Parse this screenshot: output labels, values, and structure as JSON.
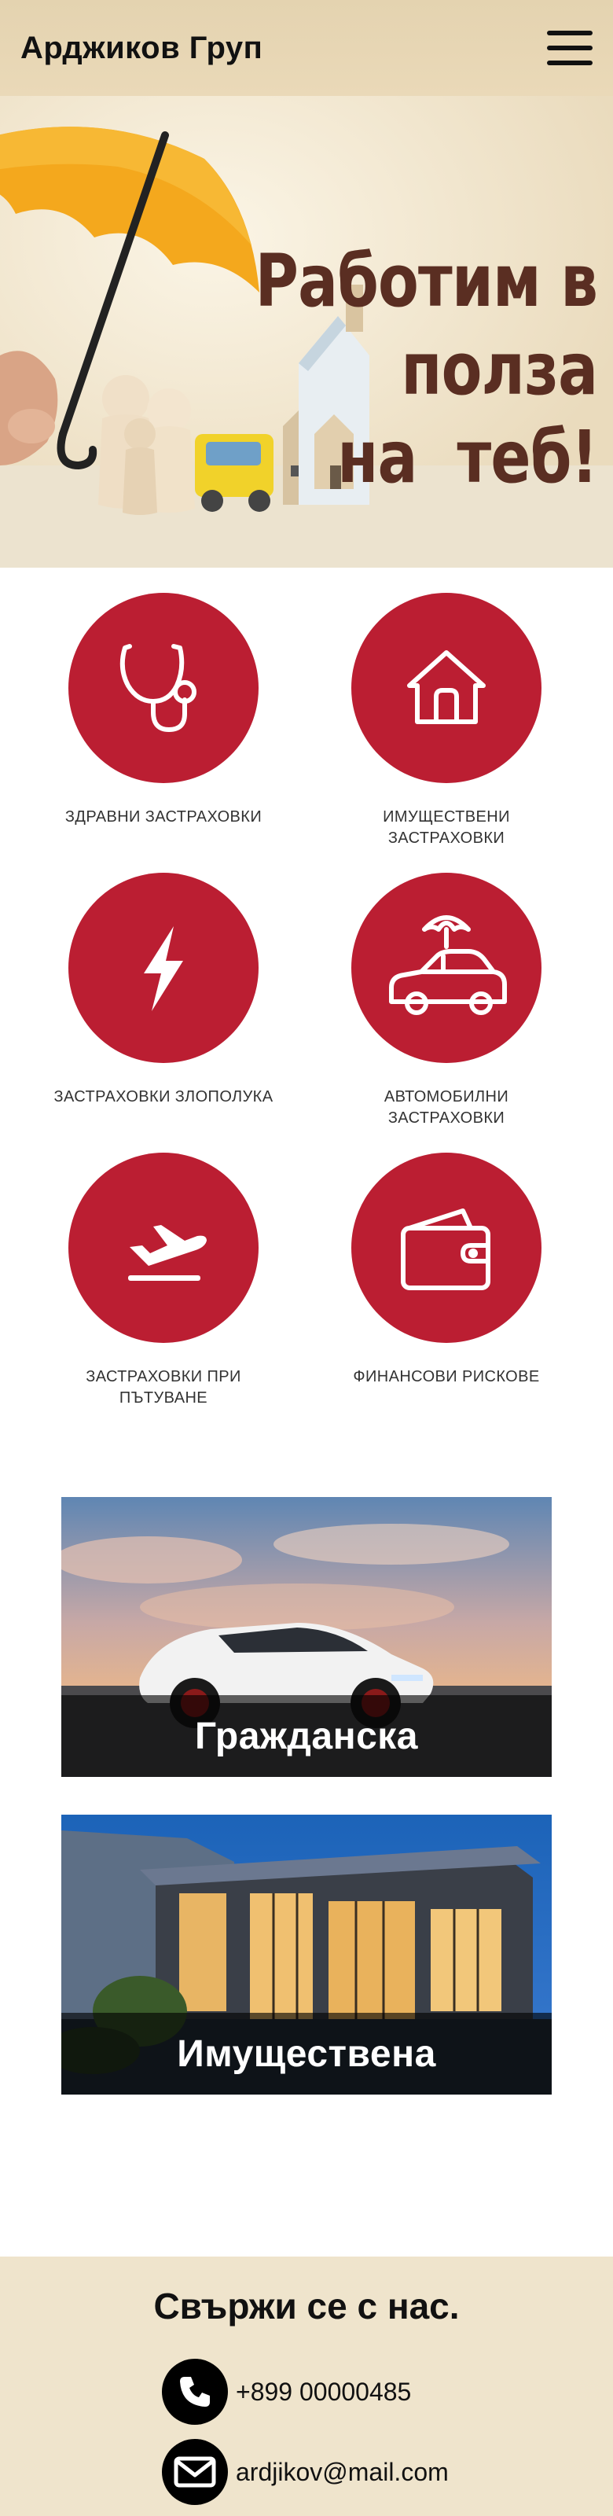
{
  "header": {
    "brand": "Арджиков Груп",
    "menu_icon": "hamburger-icon"
  },
  "hero": {
    "title_lines": [
      "Работим в",
      "полза",
      "на  теб!"
    ]
  },
  "services": [
    {
      "label_line1": "ЗДРАВНИ ЗАСТРАХОВКИ",
      "label_line2": "",
      "icon": "stethoscope-icon"
    },
    {
      "label_line1": "ИМУЩЕСТВЕНИ",
      "label_line2": "ЗАСТРАХОВКИ",
      "icon": "house-icon"
    },
    {
      "label_line1": "ЗАСТРАХОВКИ ЗЛОПОЛУКА",
      "label_line2": "",
      "icon": "lightning-icon"
    },
    {
      "label_line1": "АВТОМОБИЛНИ",
      "label_line2": "ЗАСТРАХОВКИ",
      "icon": "car-umbrella-icon"
    },
    {
      "label_line1": "ЗАСТРАХОВКИ ПРИ",
      "label_line2": "ПЪТУВАНЕ",
      "icon": "airplane-icon"
    },
    {
      "label_line1": "ФИНАНСОВИ РИСКОВЕ",
      "label_line2": "",
      "icon": "wallet-icon"
    }
  ],
  "cards": [
    {
      "label": "Гражданска"
    },
    {
      "label": "Имуществена"
    }
  ],
  "footer": {
    "heading": "Свържи се с нас.",
    "phone": "+899 00000485",
    "email": "ardjikov@mail.com",
    "colors": {
      "accent": "#bb1e32",
      "footer_bg": "#efe4cc",
      "header_bg": "#e4d3b0"
    }
  }
}
